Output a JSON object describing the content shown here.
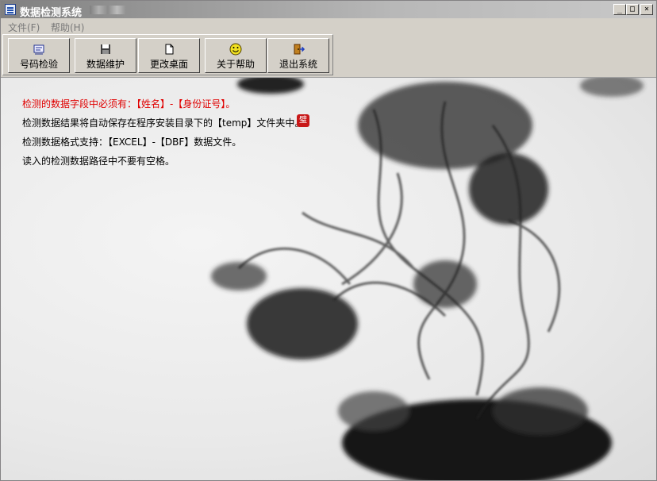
{
  "window": {
    "title": "数据检测系统"
  },
  "controls": {
    "minimize": "_",
    "maximize": "□",
    "close": "×"
  },
  "menu": {
    "items": [
      {
        "label": "文件(F)"
      },
      {
        "label": "帮助(H)"
      }
    ]
  },
  "toolbar": {
    "buttons": [
      {
        "label": "号码检验",
        "icon": "id-card-icon"
      },
      {
        "label": "数据维护",
        "icon": "floppy-disk-icon"
      },
      {
        "label": "更改桌面",
        "icon": "blank-page-icon"
      },
      {
        "label": "关于帮助",
        "icon": "smiley-icon"
      },
      {
        "label": "退出系统",
        "icon": "exit-door-icon"
      }
    ]
  },
  "content": {
    "lines": [
      "检测的数据字段中必须有：【姓名】-【身份证号】。",
      "检测数据结果将自动保存在程序安装目录下的【temp】文件夹中。",
      "检测数据格式支持：【EXCEL】-【DBF】数据文件。",
      "读入的检测数据路径中不要有空格。"
    ],
    "stamp_char": "璧"
  },
  "colors": {
    "warning_text": "#e00000",
    "stamp": "#c81818"
  }
}
